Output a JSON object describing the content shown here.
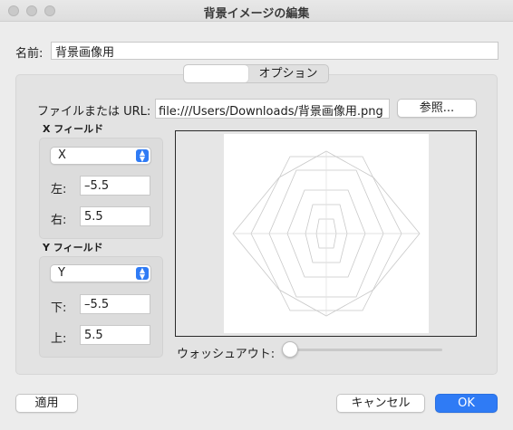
{
  "window": {
    "title": "背景イメージの編集"
  },
  "name": {
    "label": "名前:",
    "value": "背景画像用"
  },
  "tabs": [
    {
      "label": ""
    },
    {
      "label": "オプション"
    }
  ],
  "file": {
    "label": "ファイルまたは URL:",
    "value": "file:///Users/Downloads/背景画像用.png",
    "browse_label": "参照..."
  },
  "x_field": {
    "title": "X フィールド",
    "selected": "X",
    "left_label": "左:",
    "left_value": "–5.5",
    "right_label": "右:",
    "right_value": "5.5"
  },
  "y_field": {
    "title": "Y フィールド",
    "selected": "Y",
    "bottom_label": "下:",
    "bottom_value": "–5.5",
    "top_label": "上:",
    "top_value": "5.5"
  },
  "washout": {
    "label": "ウォッシュアウト:",
    "value": 0
  },
  "buttons": {
    "apply": "適用",
    "cancel": "キャンセル",
    "ok": "OK"
  },
  "colors": {
    "accent": "#2f7bf5"
  }
}
